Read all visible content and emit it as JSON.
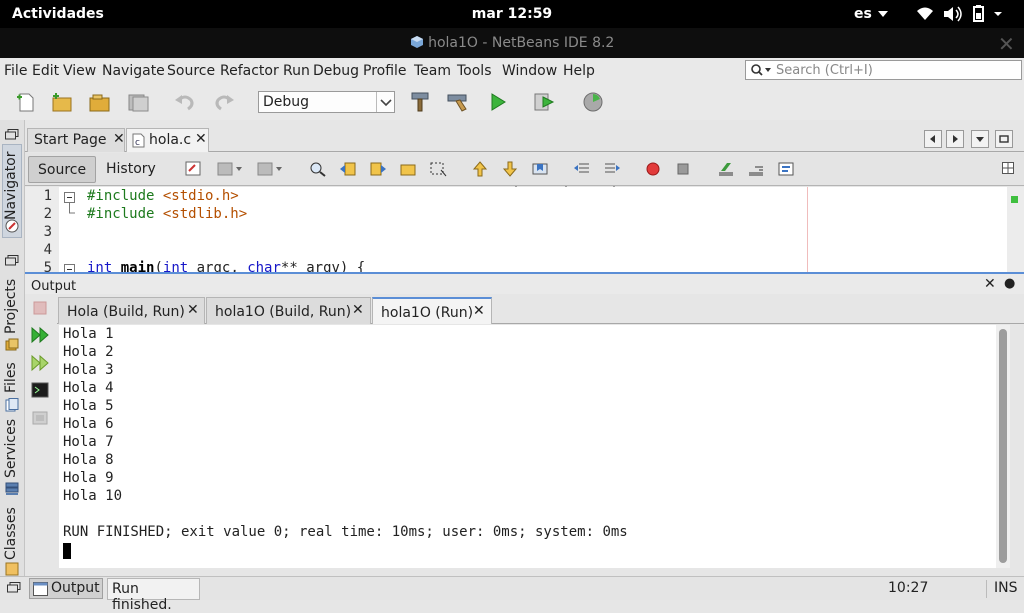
{
  "system": {
    "activities": "Actividades",
    "clock": "mar 12:59",
    "language": "es"
  },
  "window": {
    "title": "hola1O - NetBeans IDE 8.2"
  },
  "menu": {
    "items": [
      "File",
      "Edit",
      "View",
      "Navigate",
      "Source",
      "Refactor",
      "Run",
      "Debug",
      "Profile",
      "Team",
      "Tools",
      "Window",
      "Help"
    ],
    "search_placeholder": "Search (Ctrl+I)"
  },
  "toolbar": {
    "config_value": "Debug",
    "icons": [
      "new-file-icon",
      "new-project-icon",
      "open-project-icon",
      "save-all-icon",
      "undo-icon",
      "redo-icon",
      "clean-build-icon",
      "build-icon",
      "run-icon",
      "debug-icon",
      "profile-icon"
    ]
  },
  "editor": {
    "tabs": [
      {
        "label": "Start Page",
        "active": false
      },
      {
        "label": "hola.c",
        "active": true
      }
    ],
    "source_label": "Source",
    "history_label": "History",
    "lines": [
      {
        "num": "1",
        "pre": "#include ",
        "inc": "<stdio.h>"
      },
      {
        "num": "2",
        "pre": "#include ",
        "inc": "<stdlib.h>"
      },
      {
        "num": "3",
        "pre": "",
        "inc": ""
      },
      {
        "num": "4",
        "pre": "",
        "inc": ""
      },
      {
        "num": "5",
        "pre": "int main(int argc, char** argv) {",
        "inc": ""
      }
    ]
  },
  "output": {
    "title": "Output",
    "tabs": [
      {
        "label": "Hola (Build, Run)",
        "active": false
      },
      {
        "label": "hola1O (Build, Run)",
        "active": false
      },
      {
        "label": "hola1O (Run)",
        "active": true
      }
    ],
    "lines": [
      "Hola 1",
      "Hola 2",
      "Hola 3",
      "Hola 4",
      "Hola 5",
      "Hola 6",
      "Hola 7",
      "Hola 8",
      "Hola 9",
      "Hola 10",
      "",
      "RUN FINISHED; exit value 0; real time: 10ms; user: 0ms; system: 0ms"
    ]
  },
  "sidebar": {
    "tabs": [
      "Navigator",
      "Projects",
      "Files",
      "Services",
      "Classes"
    ]
  },
  "status": {
    "output_button": "Output",
    "message": "Run finished.",
    "position": "10:27",
    "mode": "INS"
  }
}
